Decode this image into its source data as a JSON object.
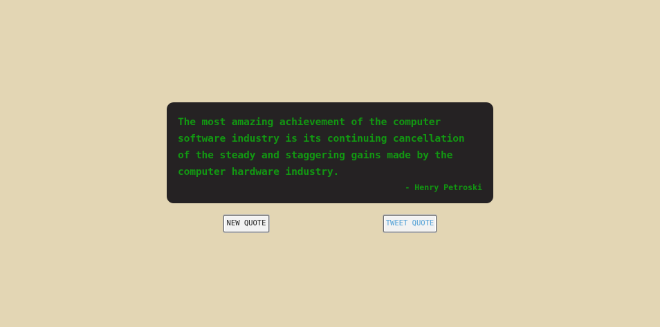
{
  "quote": {
    "text": "The most amazing achievement of the computer software industry is its continuing cancellation of the steady and staggering gains made by the computer hardware industry.",
    "author": "- Henry Petroski"
  },
  "buttons": {
    "new_quote_label": "NEW QUOTE",
    "tweet_quote_label": "TWEET QUOTE"
  },
  "colors": {
    "background": "#e3d6b4",
    "card_background": "#252223",
    "quote_text": "#129812",
    "tweet_text": "#4f9fd6"
  }
}
